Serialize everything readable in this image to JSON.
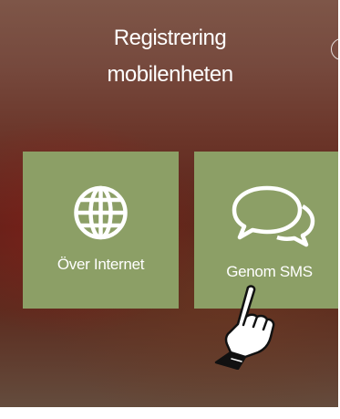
{
  "header": {
    "title_line1": "Registrering",
    "title_line2": "mobilenheten"
  },
  "options": [
    {
      "label": "Över Internet",
      "icon": "globe-icon"
    },
    {
      "label": "Genom SMS",
      "icon": "chat-bubbles-icon"
    }
  ],
  "colors": {
    "tile": "#8c9f66",
    "text": "#ffffff",
    "background": "#6a3428"
  },
  "overlay": {
    "icon": "pointing-hand-icon"
  }
}
